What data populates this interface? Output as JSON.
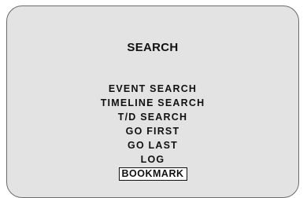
{
  "screen": {
    "title": "SEARCH",
    "menu_items": [
      {
        "label": "EVENT SEARCH",
        "selected": false
      },
      {
        "label": "TIMELINE SEARCH",
        "selected": false
      },
      {
        "label": "T/D SEARCH",
        "selected": false
      },
      {
        "label": "GO FIRST",
        "selected": false
      },
      {
        "label": "GO LAST",
        "selected": false
      },
      {
        "label": "LOG",
        "selected": false
      },
      {
        "label": "BOOKMARK",
        "selected": true
      }
    ]
  },
  "colors": {
    "panel_background": "#e3e3e3",
    "text": "#111111",
    "selection_border": "#111111"
  }
}
